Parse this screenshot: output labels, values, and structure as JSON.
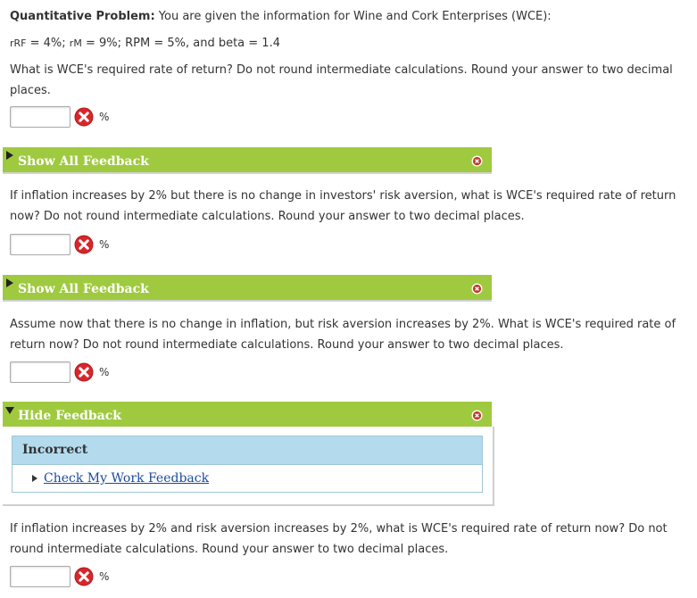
{
  "problem": {
    "title": "Quantitative Problem:",
    "intro": " You are given the information for Wine and Cork Enterprises (WCE):",
    "givens": {
      "rrf_label": "rRF",
      "rrf_value": " = 4%; ",
      "rm_label": "rM",
      "rm_value": " = 9%; ",
      "rpm_label": "RPM",
      "rpm_value": " = 5%, and beta = 1.4"
    }
  },
  "questions": [
    {
      "text": "What is WCE's required rate of return? Do not round intermediate calculations. Round your answer to two decimal places.",
      "value": "",
      "unit": "%",
      "status_icon": "incorrect-x-icon",
      "feedback_label": "Show All Feedback"
    },
    {
      "text": "If inflation increases by 2% but there is no change in investors' risk aversion, what is WCE's required rate of return now? Do not round intermediate calculations. Round your answer to two decimal places.",
      "value": "",
      "unit": "%",
      "status_icon": "incorrect-x-icon",
      "feedback_label": "Show All Feedback"
    },
    {
      "text": "Assume now that there is no change in inflation, but risk aversion increases by 2%. What is WCE's required rate of return now? Do not round intermediate calculations. Round your answer to two decimal places.",
      "value": "",
      "unit": "%",
      "status_icon": "incorrect-x-icon",
      "feedback_label": "Hide Feedback",
      "feedback_result": "Incorrect",
      "feedback_link": "Check My Work Feedback"
    },
    {
      "text": "If inflation increases by 2% and risk aversion increases by 2%, what is WCE's required rate of return now? Do not round intermediate calculations. Round your answer to two decimal places.",
      "value": "",
      "unit": "%",
      "status_icon": "incorrect-x-icon"
    }
  ],
  "colors": {
    "feedback_bar": "#9fca40",
    "feedback_header": "#b3dbed",
    "error_red": "#d9262a",
    "close_red": "#c0392b",
    "link": "#1a4b9b"
  }
}
